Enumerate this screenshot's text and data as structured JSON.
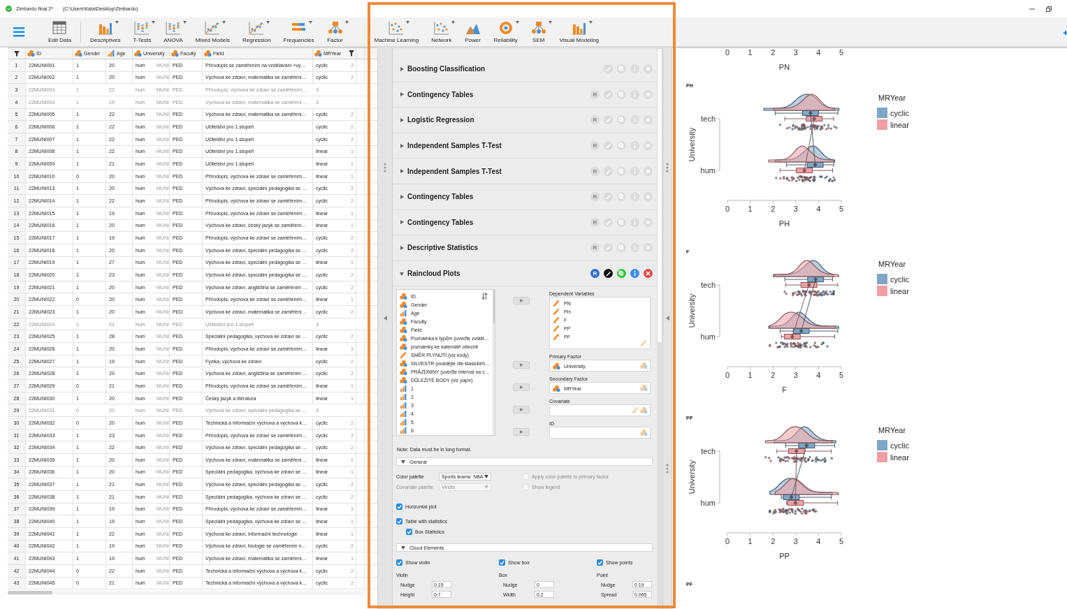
{
  "window": {
    "title": "Zimbardo final 2*",
    "path": "(C:\\Users\\Kata\\Desktop\\Zimbardo)"
  },
  "ribbon": [
    {
      "label": "Edit Data",
      "has_menu": false
    },
    {
      "label": "Descriptives",
      "has_menu": true
    },
    {
      "label": "T-Tests",
      "has_menu": true
    },
    {
      "label": "ANOVA",
      "has_menu": true
    },
    {
      "label": "Mixed Models",
      "has_menu": true
    },
    {
      "label": "Regression",
      "has_menu": true
    },
    {
      "label": "Frequencies",
      "has_menu": true
    },
    {
      "label": "Factor",
      "has_menu": true
    },
    {
      "label": "Machine Learning",
      "has_menu": true
    },
    {
      "label": "Network",
      "has_menu": true
    },
    {
      "label": "Power",
      "has_menu": false
    },
    {
      "label": "Reliability",
      "has_menu": true
    },
    {
      "label": "SEM",
      "has_menu": true
    },
    {
      "label": "Visual Modeling",
      "has_menu": true
    }
  ],
  "data_table": {
    "columns": [
      {
        "label": "ID",
        "kind": "nominal",
        "filtered": false
      },
      {
        "label": "Gender",
        "kind": "nominal",
        "filtered": false
      },
      {
        "label": "Age",
        "kind": "ordinal",
        "filtered": false
      },
      {
        "label": "University",
        "kind": "nominal",
        "filtered": false
      },
      {},
      {
        "label": "Faculty",
        "kind": "nominal",
        "filtered": false
      },
      {
        "label": "Field",
        "kind": "nominal",
        "filtered": false
      },
      {
        "label": "MRYear",
        "kind": "nominal",
        "filtered": true
      },
      {}
    ],
    "rows": [
      {
        "n": "1",
        "cells": [
          "22MUNI001",
          "1",
          "20",
          "hum",
          "MUNI",
          "PED",
          "Přírodopis se zaměřením na vzdělávání +vý…",
          "cyclic",
          "2"
        ],
        "filtered": false
      },
      {
        "n": "2",
        "cells": [
          "22MUNI002",
          "1",
          "20",
          "hum",
          "MUNI",
          "PED",
          "Výchova ke zdraví, matematika se zaměření…",
          "cyclic",
          "2"
        ],
        "filtered": false
      },
      {
        "n": "3",
        "cells": [
          "22MUNI003",
          "1",
          "22",
          "hum",
          "MUNI",
          "PED",
          "Přírodopis, výchova ke zdraví se zaměřením…",
          "3"
        ],
        "filtered": true
      },
      {
        "n": "4",
        "cells": [
          "22MUNI004",
          "1",
          "19",
          "hum",
          "MUNI",
          "PED",
          "Výchova ke zdraví, matematika se zaměření…",
          "3"
        ],
        "filtered": true
      },
      {
        "n": "5",
        "cells": [
          "22MUNI005",
          "1",
          "22",
          "hum",
          "MUNI",
          "PED",
          "Výchova ke zdraví, matematika se zaměření…",
          "cyclic",
          "2"
        ],
        "filtered": false
      },
      {
        "n": "6",
        "cells": [
          "22MUNI006",
          "1",
          "22",
          "hum",
          "MUNI",
          "PED",
          "Učitelství pro 1.stupeň",
          "cyclic",
          "2"
        ],
        "filtered": false
      },
      {
        "n": "7",
        "cells": [
          "22MUNI007",
          "1",
          "22",
          "hum",
          "MUNI",
          "PED",
          "Učitelství pro 1.stupeň",
          "cyclic",
          "2"
        ],
        "filtered": false
      },
      {
        "n": "8",
        "cells": [
          "22MUNI008",
          "1",
          "22",
          "hum",
          "MUNI",
          "PED",
          "Učitelství pro 1.stupeň",
          "linear",
          "1"
        ],
        "filtered": false
      },
      {
        "n": "9",
        "cells": [
          "22MUNI009",
          "1",
          "21",
          "hum",
          "MUNI",
          "PED",
          "Učitelství pro 1.stupeň",
          "linear",
          "1"
        ],
        "filtered": false
      },
      {
        "n": "10",
        "cells": [
          "22MUNI010",
          "0",
          "20",
          "hum",
          "MUNI",
          "PED",
          "Přírodopis, výchova ke zdraví se zaměřením…",
          "linear",
          "1"
        ],
        "filtered": false
      },
      {
        "n": "11",
        "cells": [
          "22MUNI013",
          "1",
          "20",
          "hum",
          "MUNI",
          "PED",
          "Výchova ke zdraví, speciální pedagogika se …",
          "cyclic",
          "2"
        ],
        "filtered": false
      },
      {
        "n": "12",
        "cells": [
          "22MUNI014",
          "1",
          "22",
          "hum",
          "MUNI",
          "PED",
          "Přírodopis, výchova ke zdraví se zaměřením…",
          "cyclic",
          "2"
        ],
        "filtered": false
      },
      {
        "n": "13",
        "cells": [
          "22MUNI015",
          "1",
          "19",
          "hum",
          "MUNI",
          "PED",
          "Přírodopis, výchova ke zdraví se zaměřením…",
          "linear",
          "1"
        ],
        "filtered": false
      },
      {
        "n": "14",
        "cells": [
          "22MUNI016",
          "1",
          "20",
          "hum",
          "MUNI",
          "PED",
          "Výchova ke zdraví, český jazyk se zaměření…",
          "linear",
          "1"
        ],
        "filtered": false
      },
      {
        "n": "15",
        "cells": [
          "22MUNI017",
          "1",
          "19",
          "hum",
          "MUNI",
          "PED",
          "Přírodopis, výchova ke zdraví se zaměřením…",
          "cyclic",
          "2"
        ],
        "filtered": false
      },
      {
        "n": "16",
        "cells": [
          "22MUNI018",
          "1",
          "20",
          "hum",
          "MUNI",
          "PED",
          "Výchova ke zdraví, speciální pedagogika se …",
          "cyclic",
          "2"
        ],
        "filtered": false
      },
      {
        "n": "17",
        "cells": [
          "22MUNI019",
          "1",
          "27",
          "hum",
          "MUNI",
          "PED",
          "Výchova ke zdraví, speciální pedagogika se …",
          "linear",
          "1"
        ],
        "filtered": false
      },
      {
        "n": "18",
        "cells": [
          "22MUNI020",
          "1",
          "23",
          "hum",
          "MUNI",
          "PED",
          "Výchova ke zdraví, speciální pedagogika se …",
          "cyclic",
          "2"
        ],
        "filtered": false
      },
      {
        "n": "19",
        "cells": [
          "22MUNI021",
          "1",
          "20",
          "hum",
          "MUNI",
          "PED",
          "Výchova ke zdraví, angličtina se zaměřením …",
          "cyclic",
          "2"
        ],
        "filtered": false
      },
      {
        "n": "20",
        "cells": [
          "22MUNI022",
          "0",
          "20",
          "hum",
          "MUNI",
          "PED",
          "Přírodopis, výchova ke zdraví se zaměřením…",
          "linear",
          "1"
        ],
        "filtered": false
      },
      {
        "n": "21",
        "cells": [
          "22MUNI023",
          "1",
          "20",
          "hum",
          "MUNI",
          "PED",
          "Výchova ke zdraví, matematika se zaměření…",
          "cyclic",
          "2"
        ],
        "filtered": false
      },
      {
        "n": "22",
        "cells": [
          "22MUNI024",
          "1",
          "21",
          "hum",
          "MUNI",
          "PED",
          "Učitelství pro 1.stupeň",
          "3"
        ],
        "filtered": true
      },
      {
        "n": "23",
        "cells": [
          "22MUNI025",
          "1",
          "28",
          "hum",
          "MUNI",
          "PED",
          "Speciální pedagogika, výchova ke zdraví se …",
          "cyclic",
          "2"
        ],
        "filtered": false
      },
      {
        "n": "24",
        "cells": [
          "22MUNI026",
          "1",
          "20",
          "hum",
          "MUNI",
          "PED",
          "Přírodopis, výchova ke zdraví se zaměřením…",
          "linear",
          "1"
        ],
        "filtered": false
      },
      {
        "n": "25",
        "cells": [
          "22MUNI027",
          "1",
          "19",
          "hum",
          "MUNI",
          "PED",
          "Fyzika, výchova ke zdraví",
          "cyclic",
          "2"
        ],
        "filtered": false
      },
      {
        "n": "26",
        "cells": [
          "22MUNI028",
          "1",
          "20",
          "hum",
          "MUNI",
          "PED",
          "Výchova ke zdraví, angličtina se zaměřením …",
          "cyclic",
          "2"
        ],
        "filtered": false
      },
      {
        "n": "27",
        "cells": [
          "22MUNI029",
          "0",
          "21",
          "hum",
          "MUNI",
          "PED",
          "Přírodopis, výchova ke zdraví se zaměřením…",
          "linear",
          "1"
        ],
        "filtered": false
      },
      {
        "n": "28",
        "cells": [
          "22MUNI030",
          "1",
          "20",
          "hum",
          "MUNI",
          "PED",
          "Český jazyk a literatura",
          "linear",
          "1"
        ],
        "filtered": false
      },
      {
        "n": "29",
        "cells": [
          "22MUNI031",
          "0",
          "20",
          "hum",
          "MUNI",
          "PED",
          "Výchova ke zdraví, speciální pedagogika se …",
          "3"
        ],
        "filtered": true
      },
      {
        "n": "30",
        "cells": [
          "22MUNI032",
          "0",
          "20",
          "hum",
          "MUNI",
          "PED",
          "Technická a informační výchova a výchova k…",
          "cyclic",
          "2"
        ],
        "filtered": false
      },
      {
        "n": "31",
        "cells": [
          "22MUNI033",
          "1",
          "23",
          "hum",
          "MUNI",
          "PED",
          "Přírodopis, výchova ke zdraví se zaměřením…",
          "cyclic",
          "2"
        ],
        "filtered": false
      },
      {
        "n": "32",
        "cells": [
          "22MUNI034",
          "1",
          "22",
          "hum",
          "MUNI",
          "PED",
          "Výchova ke zdraví, speciální pedagogika se …",
          "cyclic",
          "2"
        ],
        "filtered": false
      },
      {
        "n": "33",
        "cells": [
          "22MUNI035",
          "1",
          "20",
          "hum",
          "MUNI",
          "PED",
          "Výchova ke zdraví, matematika se zaměření…",
          "linear",
          "1"
        ],
        "filtered": false
      },
      {
        "n": "34",
        "cells": [
          "22MUNI036",
          "1",
          "20",
          "hum",
          "MUNI",
          "PED",
          "Speciální pedagogika, výchova ke zdraví se …",
          "linear",
          "1"
        ],
        "filtered": false
      },
      {
        "n": "35",
        "cells": [
          "22MUNI037",
          "1",
          "21",
          "hum",
          "MUNI",
          "PED",
          "Výchova ke zdraví, speciální pedagogika se …",
          "cyclic",
          "2"
        ],
        "filtered": false
      },
      {
        "n": "36",
        "cells": [
          "22MUNI038",
          "1",
          "21",
          "hum",
          "MUNI",
          "PED",
          "Speciální pedagogika, výchova ke zdraví se …",
          "cyclic",
          "2"
        ],
        "filtered": false
      },
      {
        "n": "37",
        "cells": [
          "22MUNI039",
          "1",
          "19",
          "hum",
          "MUNI",
          "PED",
          "Přírodopis, výchova ke zdraví se zaměřením…",
          "linear",
          "1"
        ],
        "filtered": false
      },
      {
        "n": "38",
        "cells": [
          "22MUNI040",
          "1",
          "19",
          "hum",
          "MUNI",
          "PED",
          "Speciální pedagogika, výchova ke zdraví se …",
          "linear",
          "1"
        ],
        "filtered": false
      },
      {
        "n": "39",
        "cells": [
          "22MUNI041",
          "1",
          "22",
          "hum",
          "MUNI",
          "PED",
          "Výchova ke zdraví, informační technologie",
          "linear",
          "1"
        ],
        "filtered": false
      },
      {
        "n": "40",
        "cells": [
          "22MUNI042",
          "1",
          "19",
          "hum",
          "MUNI",
          "PED",
          "Výchova ke zdraví, biologie se zaměřením n…",
          "cyclic",
          "2"
        ],
        "filtered": false
      },
      {
        "n": "41",
        "cells": [
          "22MUNI043",
          "1",
          "19",
          "hum",
          "MUNI",
          "PED",
          "Výchova ke zdraví, matematika se zaměření…",
          "linear",
          "1"
        ],
        "filtered": false
      },
      {
        "n": "42",
        "cells": [
          "22MUNI044",
          "0",
          "22",
          "hum",
          "MUNI",
          "PED",
          "Technická a informační výchova a výchova k…",
          "cyclic",
          "2"
        ],
        "filtered": false
      },
      {
        "n": "43",
        "cells": [
          "22MUNI045",
          "0",
          "21",
          "hum",
          "MUNI",
          "PED",
          "Technická a informační výchova a výchova k…",
          "cyclic",
          "2"
        ],
        "filtered": false
      }
    ]
  },
  "analyses": [
    {
      "title": "Boosting Classification",
      "expanded": false,
      "buttons": [
        {
          "kind": "edit"
        },
        {
          "kind": "copy"
        },
        {
          "kind": "info"
        },
        {
          "kind": "close"
        }
      ]
    },
    {
      "title": "Contingency Tables",
      "expanded": false,
      "buttons": [
        {
          "kind": "r",
          "text": "R"
        },
        {
          "kind": "edit"
        },
        {
          "kind": "copy"
        },
        {
          "kind": "info"
        },
        {
          "kind": "close"
        }
      ]
    },
    {
      "title": "Logistic Regression",
      "expanded": false,
      "buttons": [
        {
          "kind": "r",
          "text": "R"
        },
        {
          "kind": "edit"
        },
        {
          "kind": "copy"
        },
        {
          "kind": "info"
        },
        {
          "kind": "close"
        }
      ]
    },
    {
      "title": "Independent Samples T-Test",
      "expanded": false,
      "buttons": [
        {
          "kind": "r",
          "text": "R"
        },
        {
          "kind": "edit"
        },
        {
          "kind": "copy"
        },
        {
          "kind": "info"
        },
        {
          "kind": "close"
        }
      ]
    },
    {
      "title": "Independent Samples T-Test",
      "expanded": false,
      "buttons": [
        {
          "kind": "r",
          "text": "R"
        },
        {
          "kind": "edit"
        },
        {
          "kind": "copy"
        },
        {
          "kind": "info"
        },
        {
          "kind": "close"
        }
      ]
    },
    {
      "title": "Contingency Tables",
      "expanded": false,
      "buttons": [
        {
          "kind": "r",
          "text": "R"
        },
        {
          "kind": "edit"
        },
        {
          "kind": "copy"
        },
        {
          "kind": "info"
        },
        {
          "kind": "close"
        }
      ]
    },
    {
      "title": "Contingency Tables",
      "expanded": false,
      "buttons": [
        {
          "kind": "r",
          "text": "R"
        },
        {
          "kind": "edit"
        },
        {
          "kind": "copy"
        },
        {
          "kind": "info"
        },
        {
          "kind": "close"
        }
      ]
    },
    {
      "title": "Descriptive Statistics",
      "expanded": false,
      "buttons": [
        {
          "kind": "r",
          "text": "R"
        },
        {
          "kind": "edit"
        },
        {
          "kind": "copy"
        },
        {
          "kind": "info"
        },
        {
          "kind": "close"
        }
      ]
    },
    {
      "title": "Raincloud Plots",
      "expanded": true,
      "buttons": [
        {
          "kind": "r",
          "text": "R"
        },
        {
          "kind": "edit"
        },
        {
          "kind": "copy"
        },
        {
          "kind": "info"
        },
        {
          "kind": "close"
        }
      ]
    }
  ],
  "form": {
    "variables": [
      {
        "name": "ID",
        "kind": "nominal"
      },
      {
        "name": "Gender",
        "kind": "nominal"
      },
      {
        "name": "Age",
        "kind": "ordinal"
      },
      {
        "name": "Faculty",
        "kind": "nominal"
      },
      {
        "name": "Field",
        "kind": "nominal"
      },
      {
        "name": "Poznámka k typům (uveďte zvlášt…",
        "kind": "nominal"
      },
      {
        "name": "poznámky ke kalendáři obecně",
        "kind": "nominal"
      },
      {
        "name": "SMĚR PLYNUTÍ (viz kódy)",
        "kind": "scale"
      },
      {
        "name": "SILVESTR (uvádějte dle klasickéh…",
        "kind": "nominal"
      },
      {
        "name": "PRÁZDNINY (uveďte interval na c…",
        "kind": "nominal"
      },
      {
        "name": "DŮLEŽITÉ BODY (viz papír)",
        "kind": "nominal"
      },
      {
        "name": "1",
        "kind": "ordinal"
      },
      {
        "name": "2",
        "kind": "ordinal"
      },
      {
        "name": "3",
        "kind": "ordinal"
      },
      {
        "name": "4",
        "kind": "ordinal"
      },
      {
        "name": "5",
        "kind": "ordinal"
      },
      {
        "name": "6",
        "kind": "ordinal"
      }
    ],
    "assigned": [
      {
        "label": "Dependent Variables",
        "tall": true,
        "items": [
          {
            "name": "PN",
            "kind": "scale"
          },
          {
            "name": "PH",
            "kind": "scale"
          },
          {
            "name": "F",
            "kind": "scale"
          },
          {
            "name": "PP",
            "kind": "scale"
          },
          {
            "name": "PF",
            "kind": "scale"
          }
        ],
        "accepts": [
          {
            "kind": "scale"
          }
        ]
      },
      {
        "label": "Primary Factor",
        "tall": false,
        "items": [
          {
            "name": "University",
            "kind": "nominal"
          }
        ],
        "accepts": [
          {
            "kind": "nominal"
          }
        ]
      },
      {
        "label": "Secondary Factor",
        "tall": false,
        "items": [
          {
            "name": "MRYear",
            "kind": "nominal"
          }
        ],
        "accepts": [
          {
            "kind": "nominal"
          }
        ]
      },
      {
        "label": "Covariate",
        "tall": false,
        "accepts": [
          {
            "kind": "scale"
          },
          {
            "kind": "nominal"
          }
        ]
      },
      {
        "label": "ID",
        "tall": false,
        "accepts": [
          {
            "kind": "nominal"
          }
        ]
      }
    ],
    "note": "Note: Data must be in long format.",
    "general": {
      "title": "General",
      "expanded": true,
      "dropdowns": [
        {
          "label": "Color palette",
          "value": "Sports teams: NBA",
          "disabled": false
        },
        {
          "label": "Covariate palette",
          "value": "Viridis",
          "disabled": true
        }
      ],
      "side_checks": [
        {
          "label": "Apply color palette to primary factor",
          "checked": false,
          "disabled": true
        },
        {
          "label": "Show legend",
          "checked": false,
          "disabled": true
        }
      ],
      "checks": [
        {
          "label": "Horizontal plot",
          "checked": true
        },
        {
          "label": "Table with statistics",
          "checked": true,
          "children": [
            {
              "label": "Box Statistics",
              "checked": true
            }
          ]
        }
      ]
    },
    "cloud": {
      "title": "Cloud Elements",
      "expanded": true,
      "checks": [
        {
          "label": "Show violin",
          "checked": true
        },
        {
          "label": "Show box",
          "checked": true
        },
        {
          "label": "Show points",
          "checked": true
        }
      ],
      "groups": [
        {
          "title": "Violin",
          "fields": [
            {
              "label": "Nudge",
              "value": "0.15"
            },
            {
              "label": "Height",
              "value": "0.7"
            }
          ]
        },
        {
          "title": "Box",
          "fields": [
            {
              "label": "Nudge",
              "value": "0"
            },
            {
              "label": "Width",
              "value": "0.2"
            }
          ]
        },
        {
          "title": "Point",
          "fields": [
            {
              "label": "Nudge",
              "value": "0.19"
            },
            {
              "label": "Spread",
              "value": "0.065"
            }
          ]
        }
      ]
    }
  },
  "results": {
    "top_axis": {
      "ticks": [
        "0",
        "1",
        "2",
        "3",
        "4",
        "5"
      ],
      "xlabel": "PN"
    },
    "plots": [
      {
        "title": "PH",
        "ylabel": "University",
        "categories": [
          "tech",
          "hum"
        ],
        "ticks": [
          "0",
          "1",
          "2",
          "3",
          "4",
          "5"
        ],
        "xlabel": "PH",
        "legend": {
          "title": "MRYear",
          "items": [
            {
              "label": "cyclic",
              "color": "#7fa6c5"
            },
            {
              "label": "linear",
              "color": "#f0a0a4"
            }
          ]
        }
      },
      {
        "title": "F",
        "ylabel": "University",
        "categories": [
          "tech",
          "hum"
        ],
        "ticks": [
          "0",
          "1",
          "2",
          "3",
          "4",
          "5"
        ],
        "xlabel": "F",
        "legend": {
          "title": "MRYear",
          "items": [
            {
              "label": "cyclic",
              "color": "#7fa6c5"
            },
            {
              "label": "linear",
              "color": "#f0a0a4"
            }
          ]
        }
      },
      {
        "title": "PP",
        "ylabel": "University",
        "categories": [
          "tech",
          "hum"
        ],
        "ticks": [
          "0",
          "1",
          "2",
          "3",
          "4",
          "5"
        ],
        "xlabel": "PP",
        "legend": {
          "title": "MRYear",
          "items": [
            {
              "label": "cyclic",
              "color": "#7fa6c5"
            },
            {
              "label": "linear",
              "color": "#f0a0a4"
            }
          ]
        }
      },
      {
        "title": "PF"
      }
    ]
  }
}
